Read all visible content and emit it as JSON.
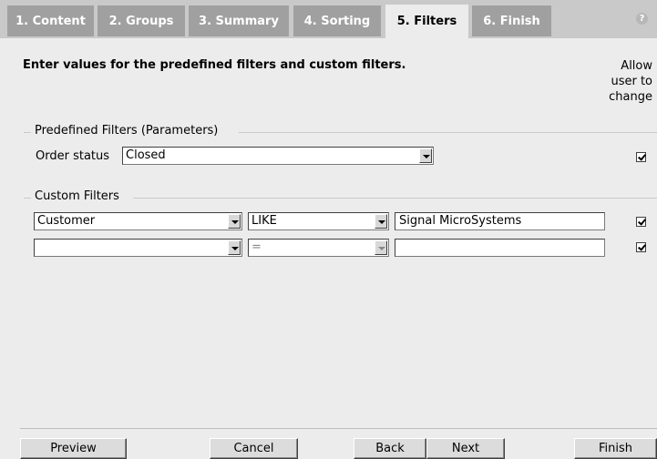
{
  "tabs": [
    {
      "label": "1. Content"
    },
    {
      "label": "2. Groups"
    },
    {
      "label": "3. Summary"
    },
    {
      "label": "4. Sorting"
    },
    {
      "label": "5. Filters",
      "active": true
    },
    {
      "label": "6. Finish"
    }
  ],
  "help_icon": "help-icon",
  "heading": "Enter values for the predefined filters and custom filters.",
  "allow_change": {
    "line1": "Allow",
    "line2": "user to",
    "line3": "change"
  },
  "predefined": {
    "group_label": "Predefined Filters (Parameters)",
    "order_status_label": "Order status",
    "order_status_value": "Closed",
    "allow_checked": true
  },
  "custom": {
    "group_label": "Custom Filters",
    "rows": [
      {
        "field": "Customer",
        "operator": "LIKE",
        "value": "Signal MicroSystems",
        "allow_checked": true
      },
      {
        "field": "",
        "operator": "=",
        "value": "",
        "allow_checked": true
      }
    ]
  },
  "buttons": {
    "preview": "Preview",
    "cancel": "Cancel",
    "back": "Back",
    "next": "Next",
    "finish": "Finish"
  },
  "colors": {
    "tab_inactive": "#a0a0a0",
    "tab_active": "#ececec",
    "background": "#ececec"
  }
}
